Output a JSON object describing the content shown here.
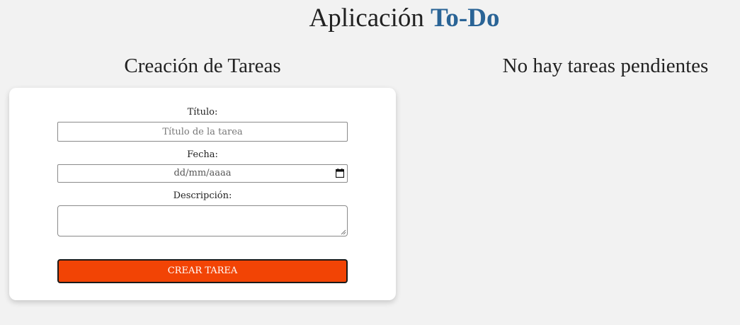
{
  "header": {
    "title_prefix": "Aplicación ",
    "title_accent": "To-Do",
    "accent_color": "#2a6496"
  },
  "creation": {
    "section_title": "Creación de Tareas",
    "title_label": "Título:",
    "title_placeholder": "Título de la tarea",
    "title_value": "",
    "date_label": "Fecha:",
    "date_placeholder": "dd/mm/aaaa",
    "date_icon": "calendar-icon",
    "description_label": "Descripción:",
    "description_value": "",
    "submit_label": "CREAR TAREA",
    "submit_color": "#f24405"
  },
  "tasks": {
    "empty_message": "No hay tareas pendientes"
  }
}
